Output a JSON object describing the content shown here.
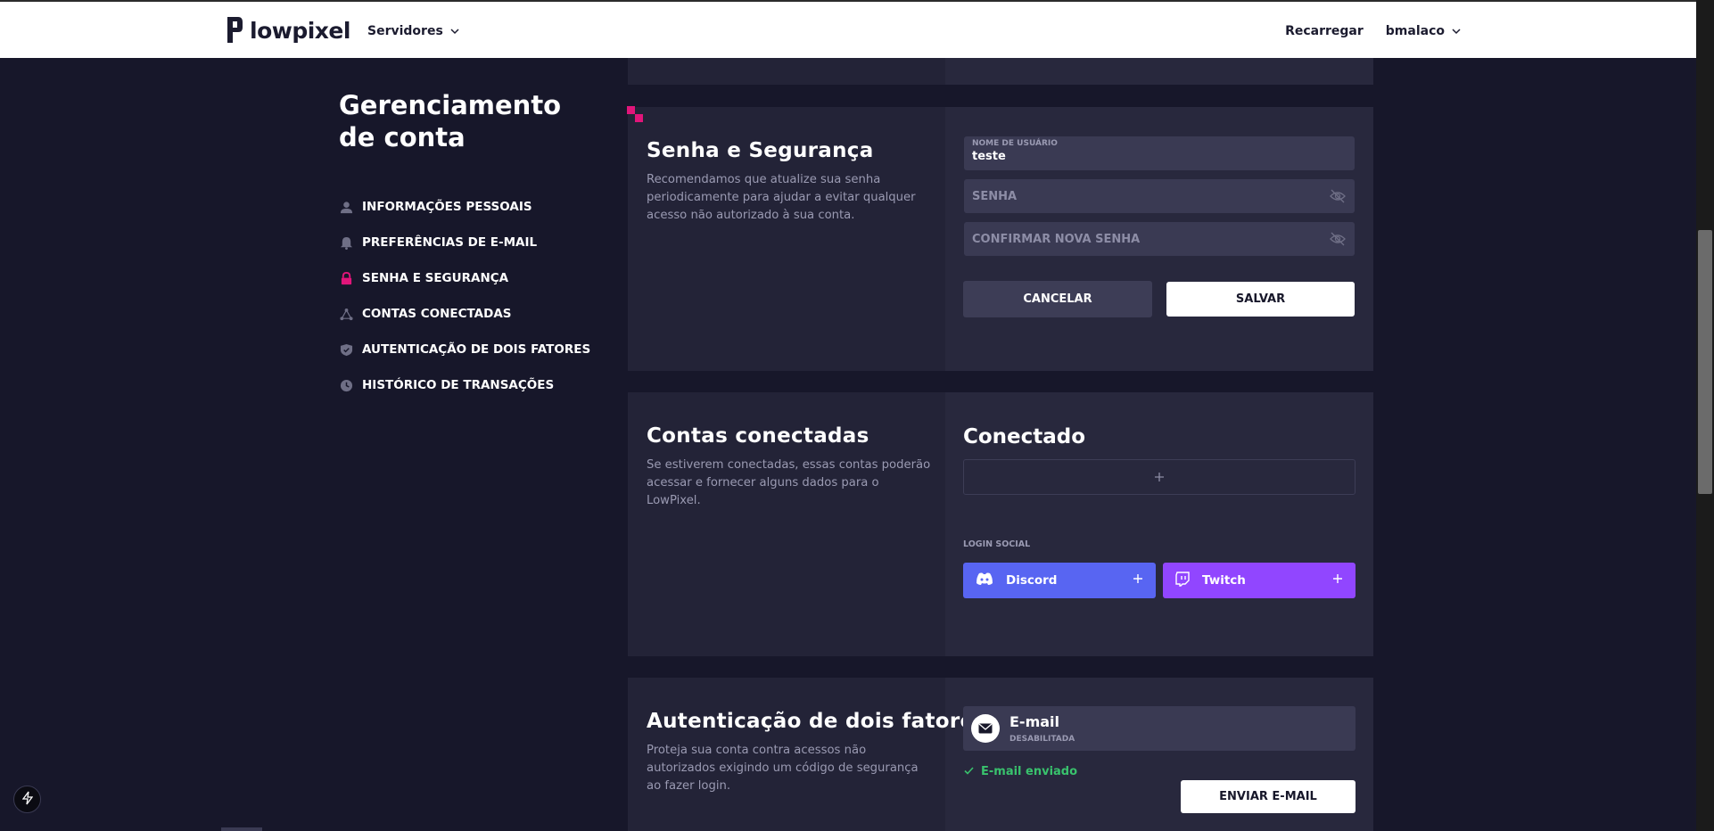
{
  "header": {
    "logo_text": "lowpixel",
    "servers_label": "Servidores",
    "reload_label": "Recarregar",
    "username": "bmalaco"
  },
  "sidebar": {
    "title_line1": "Gerenciamento",
    "title_line2": "de conta",
    "items": [
      {
        "label": "INFORMAÇÕES PESSOAIS",
        "icon": "user-icon"
      },
      {
        "label": "PREFERÊNCIAS DE E-MAIL",
        "icon": "bell-icon"
      },
      {
        "label": "SENHA E SEGURANÇA",
        "icon": "lock-icon",
        "active": true
      },
      {
        "label": "CONTAS CONECTADAS",
        "icon": "network-icon"
      },
      {
        "label": "AUTENTICAÇÃO DE DOIS FATORES",
        "icon": "shield-check-icon"
      },
      {
        "label": "HISTÓRICO DE TRANSAÇÕES",
        "icon": "clock-icon"
      }
    ]
  },
  "security": {
    "title": "Senha e Segurança",
    "description": "Recomendamos que atualize sua senha periodicamente para ajudar a evitar qualquer acesso não autorizado à sua conta.",
    "username_label": "NOME DE USUÁRIO",
    "username_value": "teste",
    "password_placeholder": "SENHA",
    "confirm_placeholder": "CONFIRMAR NOVA SENHA",
    "cancel_label": "CANCELAR",
    "save_label": "SALVAR"
  },
  "connected": {
    "title": "Contas conectadas",
    "description": "Se estiverem conectadas, essas contas poderão acessar e fornecer alguns dados para o LowPixel.",
    "connected_heading": "Conectado",
    "social_label": "LOGIN SOCIAL",
    "discord_label": "Discord",
    "twitch_label": "Twitch"
  },
  "twofa": {
    "title": "Autenticação de dois fatores",
    "description": "Proteja sua conta contra acessos não autorizados exigindo um código de segurança ao fazer login.",
    "method_title": "E-mail",
    "method_status": "DESABILITADA",
    "sent_text": "E-mail enviado",
    "send_label": "ENVIAR E-MAIL"
  },
  "colors": {
    "background": "#17172a",
    "panel": "#232337",
    "accent": "#e1157a",
    "discord": "#5865f2",
    "twitch": "#9146ff",
    "success": "#39c26d"
  }
}
